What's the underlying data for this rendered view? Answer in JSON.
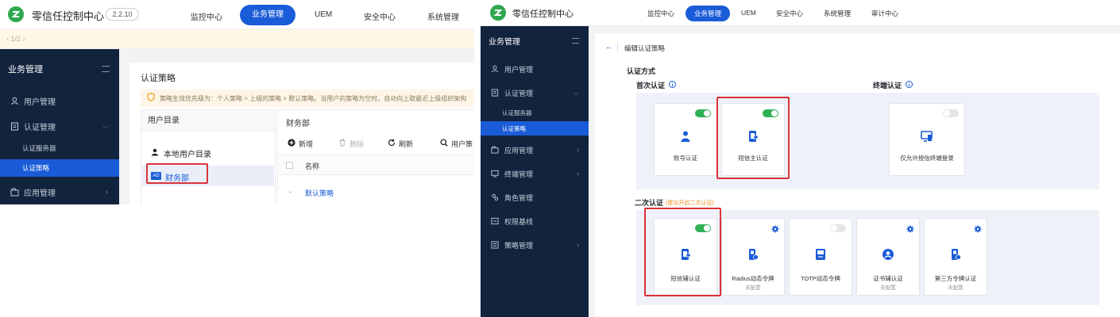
{
  "left": {
    "brand": "零信任控制中心",
    "version": "2.2.10",
    "nav": [
      "监控中心",
      "业务管理",
      "UEM",
      "安全中心",
      "系统管理"
    ],
    "nav_active_index": 1,
    "pager": "‹ 1/2 ›",
    "sidebar": {
      "title": "业务管理",
      "items": [
        {
          "label": "用户管理",
          "icon": "user-icon"
        },
        {
          "label": "认证管理",
          "icon": "auth-icon",
          "expanded": true
        },
        {
          "label": "应用管理",
          "icon": "app-icon"
        }
      ],
      "sub_items": [
        "认证服务器",
        "认证策略"
      ],
      "active_sub": "认证策略"
    },
    "page_title": "认证策略",
    "notice": "策略生效优先级为：个人策略 > 上级的策略 > 默认策略。当用户的策略为空时，自动向上取最近上级组织架构",
    "tree": {
      "header": "用户目录",
      "root": "本地用户目录",
      "ad_badge": "AD",
      "selected": "财务部"
    },
    "list": {
      "header": "财务部",
      "toolbar": {
        "add": "新增",
        "delete": "删除",
        "refresh": "刷新",
        "user_policy": "用户策"
      },
      "column_name": "名称",
      "rows": [
        {
          "bullet": "-",
          "name": "默认策略"
        }
      ]
    }
  },
  "right": {
    "brand": "零信任控制中心",
    "nav": [
      "监控中心",
      "业务管理",
      "UEM",
      "安全中心",
      "系统管理",
      "审计中心"
    ],
    "nav_active_index": 1,
    "sidebar": {
      "title": "业务管理",
      "items": [
        {
          "label": "用户管理",
          "icon": "user-icon"
        },
        {
          "label": "认证管理",
          "icon": "auth-icon",
          "expanded": true
        },
        {
          "label": "应用管理",
          "icon": "app-icon"
        },
        {
          "label": "终端管理",
          "icon": "terminal-icon"
        },
        {
          "label": "角色管理",
          "icon": "role-icon"
        },
        {
          "label": "权限基线",
          "icon": "baseline-icon"
        },
        {
          "label": "策略管理",
          "icon": "policy-icon"
        }
      ],
      "sub_items": [
        "认证服务器",
        "认证策略"
      ],
      "active_sub": "认证策略"
    },
    "breadcrumb": "编辑认证策略",
    "section": "认证方式",
    "first_auth": {
      "title": "首次认证",
      "cards": [
        {
          "label": "账号认证",
          "toggle": "on",
          "icon": "person-icon"
        },
        {
          "label": "短信主认证",
          "toggle": "on",
          "icon": "sms-icon"
        }
      ]
    },
    "terminal_auth": {
      "title": "终端认证",
      "cards": [
        {
          "label": "仅允许授信终端登录",
          "toggle": "off",
          "icon": "device-icon"
        }
      ]
    },
    "second_auth": {
      "title": "二次认证",
      "hint": "(建议开启二次认证)",
      "cards": [
        {
          "label": "短信辅认证",
          "sub": "",
          "toggle": "on",
          "icon": "sms-icon"
        },
        {
          "label": "Radius动态令牌",
          "sub": "未配置",
          "toggle": "",
          "icon": "token-icon"
        },
        {
          "label": "TOTP动态令牌",
          "sub": "",
          "toggle": "off",
          "icon": "totp-icon"
        },
        {
          "label": "证书辅认证",
          "sub": "未配置",
          "toggle": "",
          "icon": "cert-icon"
        },
        {
          "label": "第三方令牌认证",
          "sub": "未配置",
          "toggle": "",
          "icon": "token-icon"
        }
      ]
    }
  },
  "colors": {
    "primary": "#1a5cd8",
    "sidebar": "#12233e",
    "toggle_on": "#2fb155",
    "highlight": "#d9323a",
    "hint": "#f08c1a"
  }
}
